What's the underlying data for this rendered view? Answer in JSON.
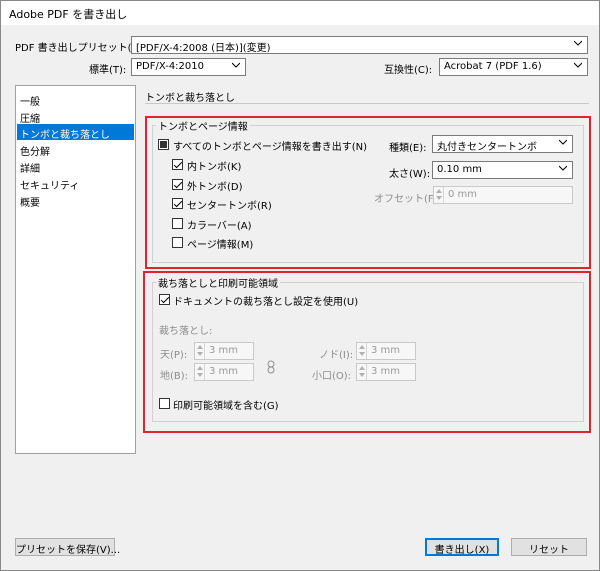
{
  "window": {
    "title": "Adobe PDF を書き出し"
  },
  "header": {
    "preset_label": "PDF 書き出しプリセット(S):",
    "preset_value": "[PDF/X-4:2008 (日本)](変更)",
    "standard_label": "標準(T):",
    "standard_value": "PDF/X-4:2010",
    "compat_label": "互換性(C):",
    "compat_value": "Acrobat 7 (PDF 1.6)"
  },
  "sidebar": {
    "items": [
      {
        "label": "一般"
      },
      {
        "label": "圧縮"
      },
      {
        "label": "トンボと裁ち落とし"
      },
      {
        "label": "色分解"
      },
      {
        "label": "詳細"
      },
      {
        "label": "セキュリティ"
      },
      {
        "label": "概要"
      }
    ]
  },
  "main": {
    "section_title": "トンボと裁ち落とし",
    "marks": {
      "group_title": "トンボとページ情報",
      "all_label": "すべてのトンボとページ情報を書き出す(N)",
      "crop_label": "内トンボ(K)",
      "bleed_label": "外トンボ(D)",
      "reg_label": "センタートンボ(R)",
      "colorbar_label": "カラーバー(A)",
      "pageinfo_label": "ページ情報(M)",
      "type_label": "種類(E):",
      "type_value": "丸付きセンタートンボ",
      "weight_label": "太さ(W):",
      "weight_value": "0.10 mm",
      "offset_label": "オフセット(F):",
      "offset_value": "0 mm"
    },
    "bleed": {
      "group_title": "裁ち落としと印刷可能領域",
      "use_doc_label": "ドキュメントの裁ち落とし設定を使用(U)",
      "bleed_label": "裁ち落とし:",
      "top_label": "天(P):",
      "top_value": "3 mm",
      "bottom_label": "地(B):",
      "bottom_value": "3 mm",
      "inside_label": "ノド(I):",
      "inside_value": "3 mm",
      "outside_label": "小口(O):",
      "outside_value": "3 mm",
      "slug_label": "印刷可能領域を含む(G)"
    }
  },
  "footer": {
    "save_preset_label": "プリセットを保存(V)...",
    "export_label": "書き出し(X)",
    "reset_label": "リセット"
  },
  "colors": {
    "accent": "#0078d7",
    "highlight_box": "#e0232c"
  }
}
